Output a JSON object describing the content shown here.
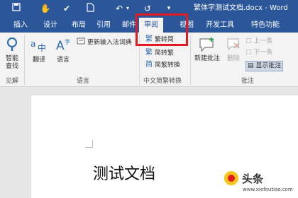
{
  "window": {
    "title": "繁体字测试文档.docx - Word"
  },
  "tabs": [
    {
      "label": "插入",
      "active": false
    },
    {
      "label": "设计",
      "active": false
    },
    {
      "label": "布局",
      "active": false
    },
    {
      "label": "引用",
      "active": false
    },
    {
      "label": "邮件",
      "active": false
    },
    {
      "label": "审阅",
      "active": true
    },
    {
      "label": "视图",
      "active": false
    },
    {
      "label": "开发工具",
      "active": false
    },
    {
      "label": "特色功能",
      "active": false
    }
  ],
  "ribbon": {
    "groups": {
      "insights": {
        "label": "见解",
        "smart_lookup": "智能\n查找"
      },
      "language": {
        "label": "语言",
        "translate": "翻译",
        "language": "语言",
        "update_ime": "更新输入法词典"
      },
      "chinese_conversion": {
        "label": "中文简繁转换",
        "trad_to_simp": "繁转简",
        "simp_to_trad": "简转繁",
        "convert": "简繁转换"
      },
      "comments": {
        "label": "批注",
        "new_comment": "新建批注",
        "delete": "删除",
        "previous": "上一条",
        "next": "下一条",
        "show_comments": "显示批注"
      }
    }
  },
  "document": {
    "body_text": "测试文档"
  },
  "watermark": {
    "brand": "头条",
    "url": "www.xiefoutiao.com"
  },
  "colors": {
    "titlebar": "#2b579a",
    "ribbon": "#f3f3f3",
    "highlight_box": "#e21b22"
  }
}
